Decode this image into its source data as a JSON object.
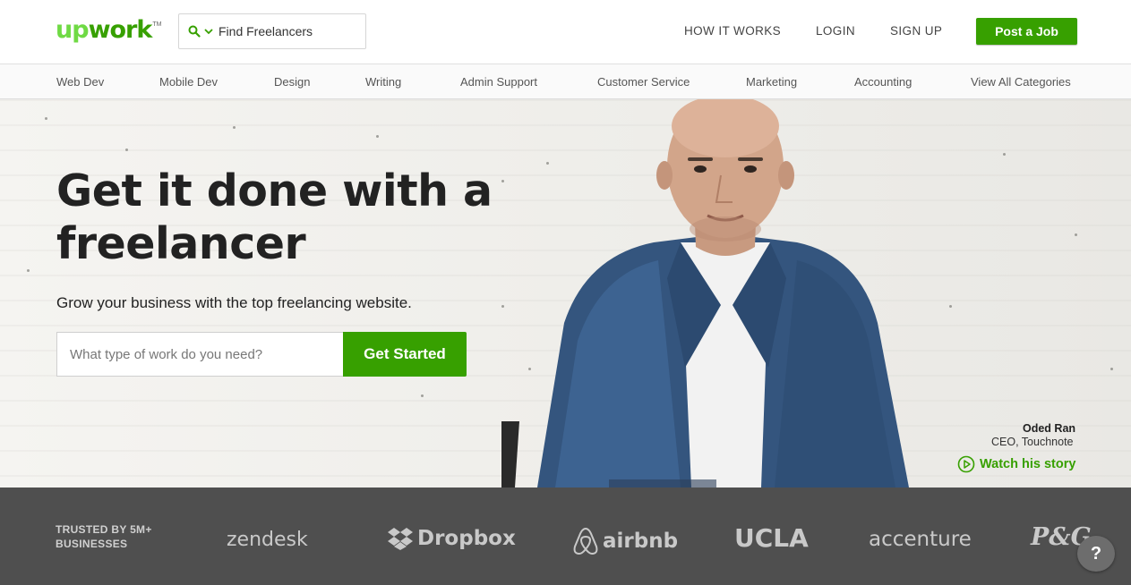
{
  "header": {
    "logo": "upwork",
    "logo_tm": "TM",
    "search_label": "Find Freelancers",
    "nav": [
      "HOW IT WORKS",
      "LOGIN",
      "SIGN UP"
    ],
    "post_job": "Post a Job"
  },
  "categories": [
    "Web Dev",
    "Mobile Dev",
    "Design",
    "Writing",
    "Admin Support",
    "Customer Service",
    "Marketing",
    "Accounting",
    "View All Categories"
  ],
  "hero": {
    "title_line1": "Get it done with a",
    "title_line2": "freelancer",
    "subtitle": "Grow your business with the top freelancing website.",
    "input_placeholder": "What type of work do you need?",
    "cta": "Get Started"
  },
  "story": {
    "name": "Oded Ran",
    "role": "CEO, Touchnote",
    "link": "Watch his story"
  },
  "trusted": {
    "label_line1": "TRUSTED BY 5M+",
    "label_line2": "BUSINESSES",
    "brands": [
      "zendesk",
      "Dropbox",
      "airbnb",
      "UCLA",
      "accenture",
      "P&G"
    ]
  },
  "help": "?",
  "colors": {
    "brand_green": "#37a000",
    "logo_light_green": "#6fda44",
    "trusted_bg": "#4f4f4f"
  },
  "icons": {
    "search": "search-icon",
    "dropdown": "chevron-down-icon",
    "play": "play-circle-icon",
    "dropbox": "dropbox-logo-icon",
    "airbnb": "airbnb-logo-icon"
  }
}
